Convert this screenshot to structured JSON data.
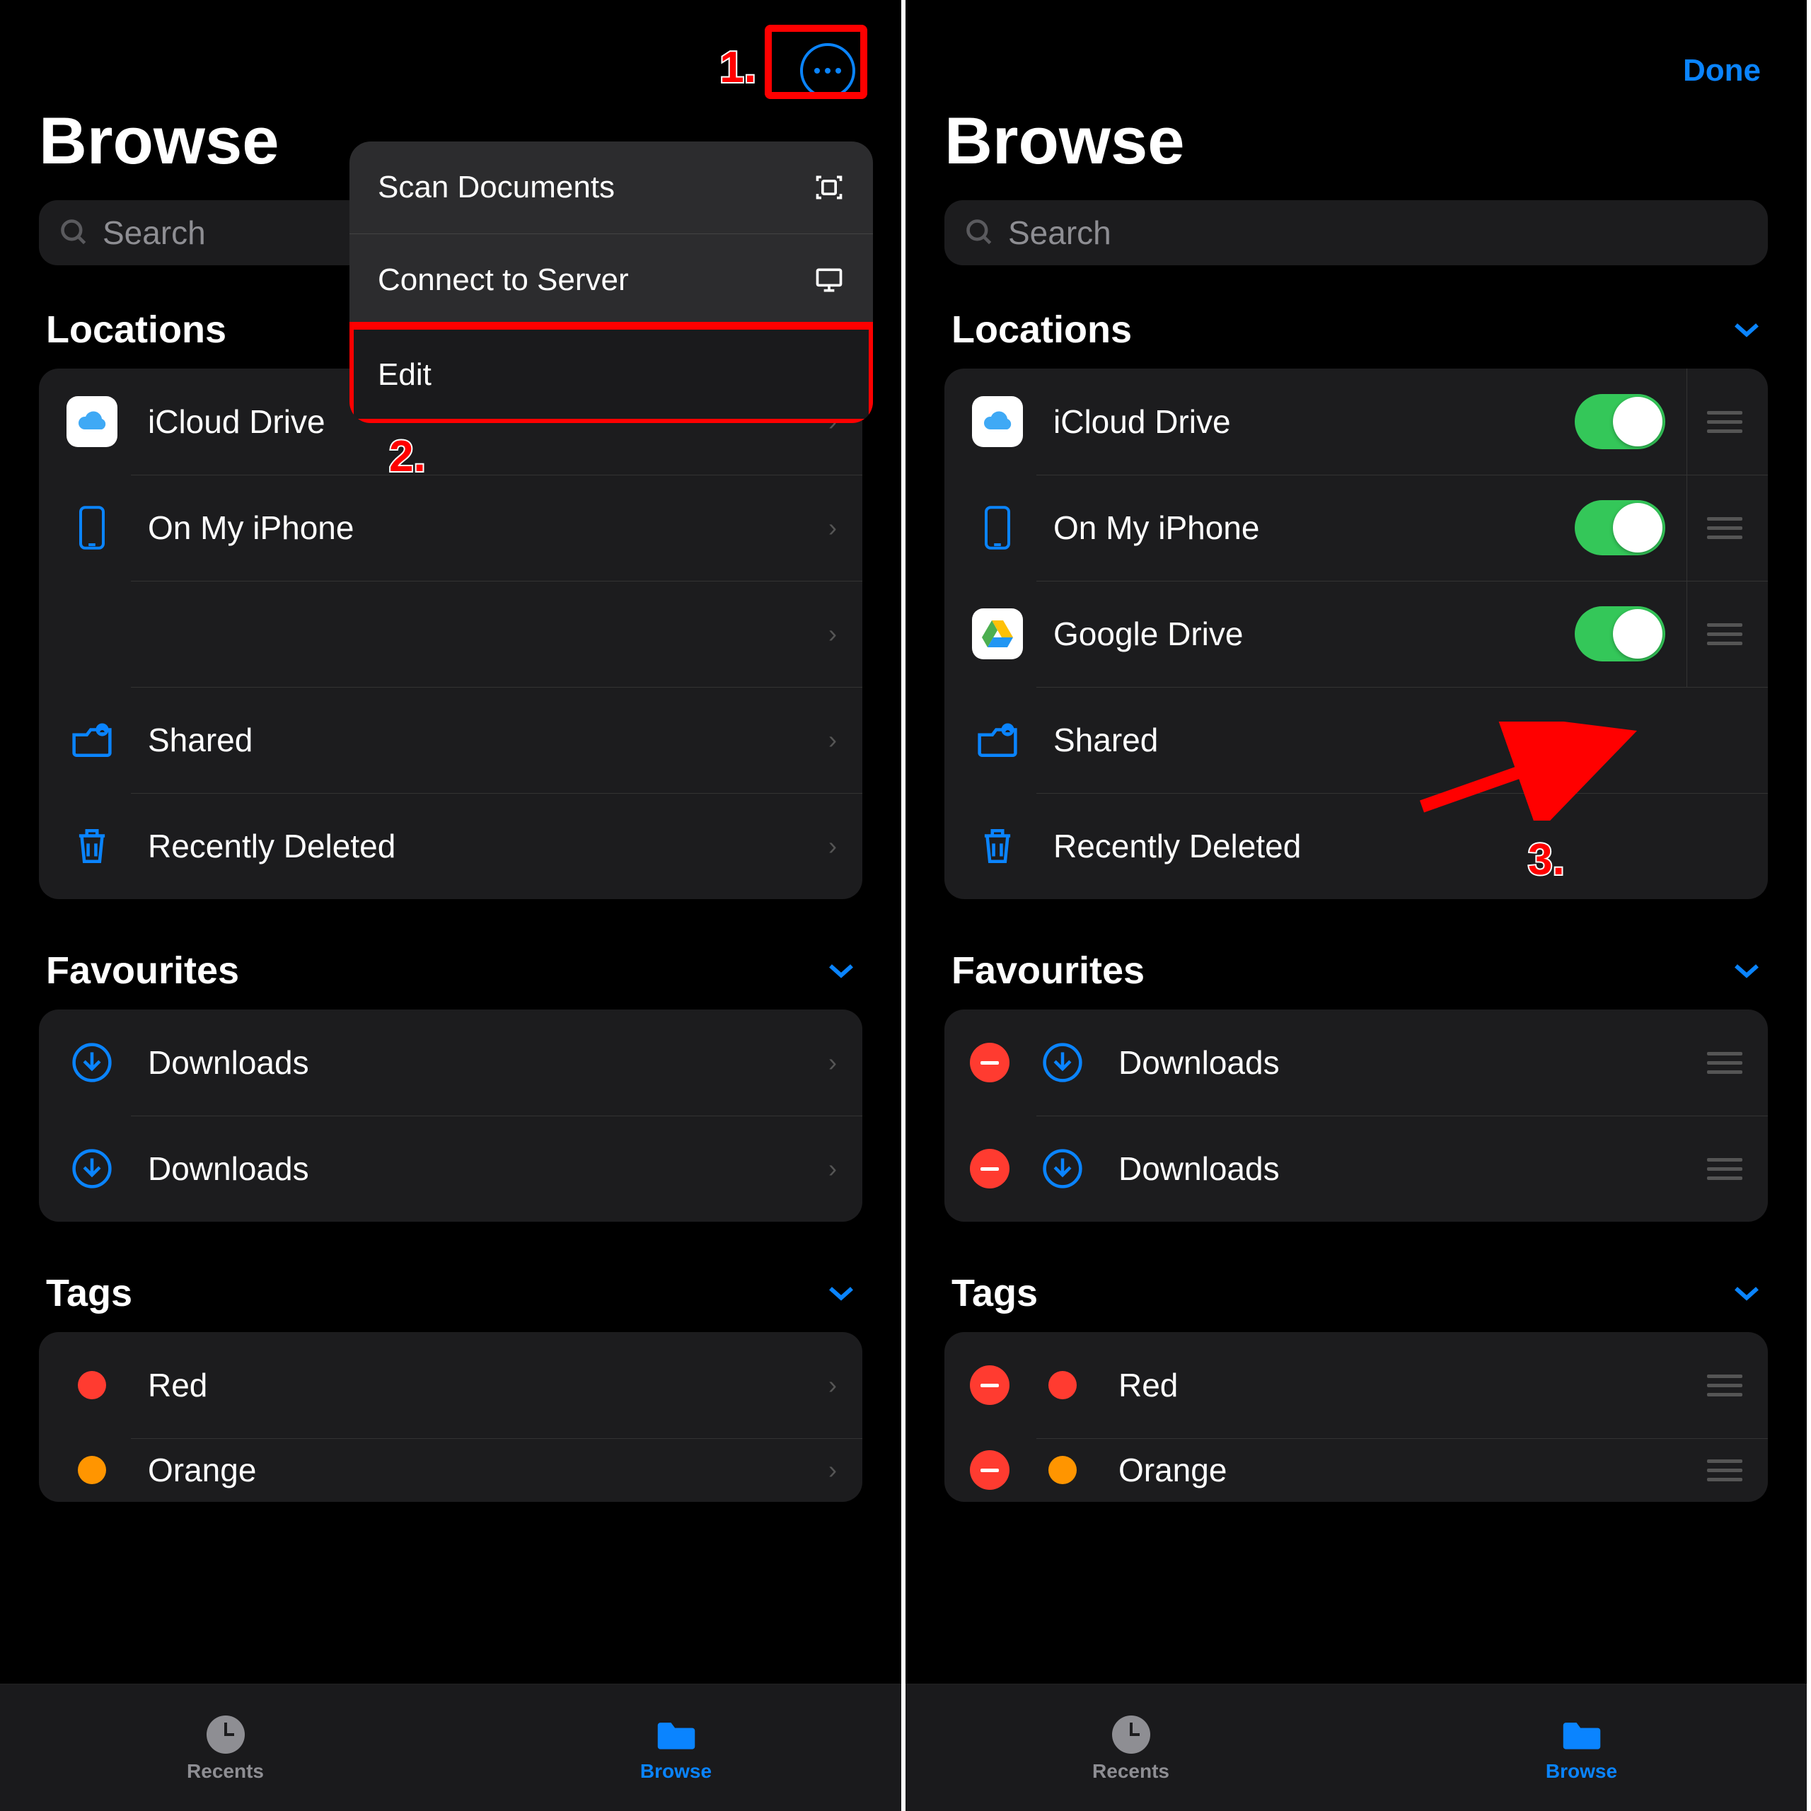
{
  "left": {
    "title": "Browse",
    "search_placeholder": "Search",
    "menu": {
      "scan": "Scan Documents",
      "connect": "Connect to Server",
      "edit": "Edit"
    },
    "sections": {
      "locations": {
        "title": "Locations",
        "items": [
          {
            "label": "iCloud Drive"
          },
          {
            "label": "On My iPhone"
          },
          {
            "label": ""
          },
          {
            "label": "Shared"
          },
          {
            "label": "Recently Deleted"
          }
        ]
      },
      "favourites": {
        "title": "Favourites",
        "items": [
          {
            "label": "Downloads"
          },
          {
            "label": "Downloads"
          }
        ]
      },
      "tags": {
        "title": "Tags",
        "items": [
          {
            "label": "Red",
            "color": "#ff3b30"
          },
          {
            "label": "Orange",
            "color": "#ff9500"
          }
        ]
      }
    },
    "annot1": "1.",
    "annot2": "2."
  },
  "right": {
    "title": "Browse",
    "done": "Done",
    "search_placeholder": "Search",
    "sections": {
      "locations": {
        "title": "Locations",
        "items": [
          {
            "label": "iCloud Drive"
          },
          {
            "label": "On My iPhone"
          },
          {
            "label": "Google Drive"
          },
          {
            "label": "Shared"
          },
          {
            "label": "Recently Deleted"
          }
        ]
      },
      "favourites": {
        "title": "Favourites",
        "items": [
          {
            "label": "Downloads"
          },
          {
            "label": "Downloads"
          }
        ]
      },
      "tags": {
        "title": "Tags",
        "items": [
          {
            "label": "Red",
            "color": "#ff3b30"
          },
          {
            "label": "Orange",
            "color": "#ff9500"
          }
        ]
      }
    },
    "annot3": "3."
  },
  "tabbar": {
    "recents": "Recents",
    "browse": "Browse"
  }
}
